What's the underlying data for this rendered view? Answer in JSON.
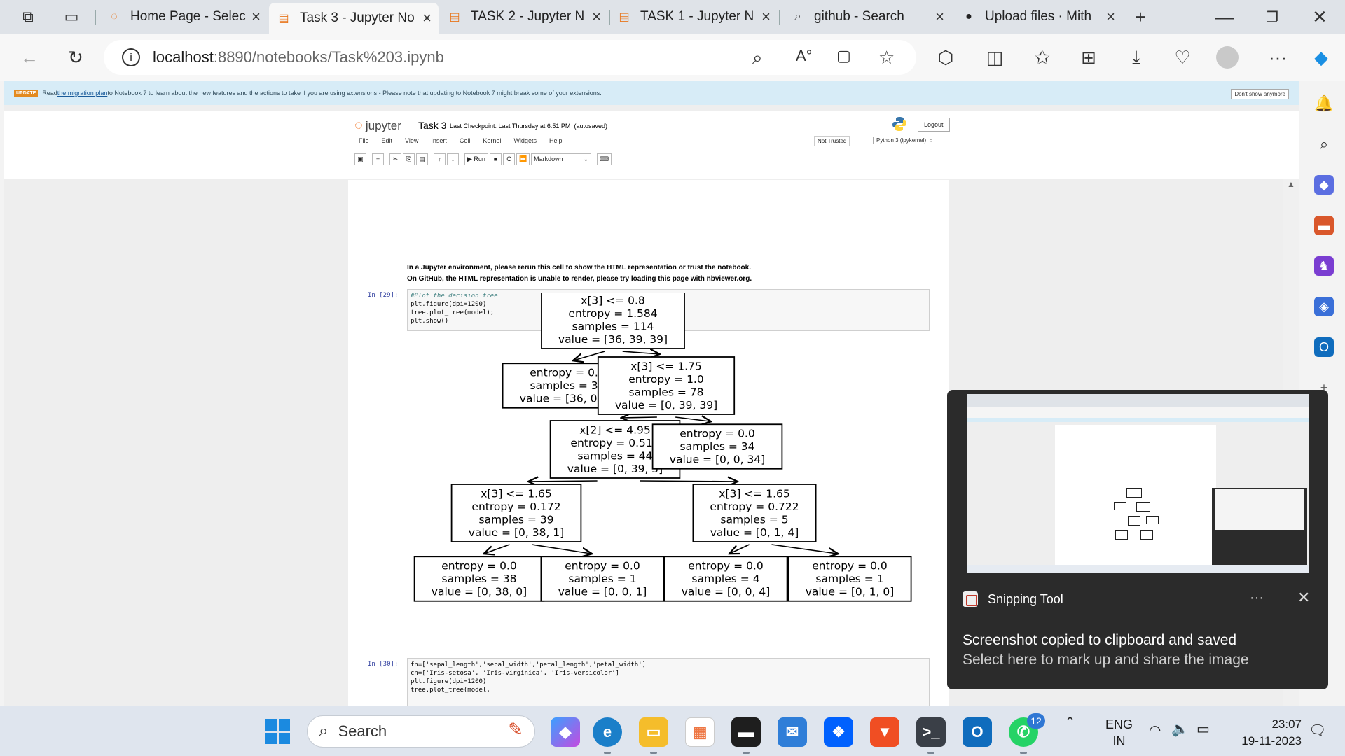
{
  "tabs": [
    {
      "title": "Home Page - Selec",
      "icon": "loading-spinner-icon",
      "active": false
    },
    {
      "title": "Task 3 - Jupyter No",
      "icon": "jupyter-notebook-icon",
      "active": true
    },
    {
      "title": "TASK 2 - Jupyter N",
      "icon": "jupyter-notebook-icon",
      "active": false
    },
    {
      "title": "TASK 1 - Jupyter N",
      "icon": "jupyter-notebook-icon",
      "active": false
    },
    {
      "title": "github - Search",
      "icon": "search-icon",
      "active": false
    },
    {
      "title": "Upload files · Mith",
      "icon": "github-icon",
      "active": false
    }
  ],
  "address": {
    "host": "localhost",
    "path": ":8890/notebooks/Task%203.ipynb"
  },
  "update_banner": {
    "badge": "UPDATE",
    "text_before": "Read ",
    "link": "the migration plan",
    "text_after": " to Notebook 7 to learn about the new features and the actions to take if you are using extensions - Please note that updating to Notebook 7 might break some of your extensions.",
    "dismiss": "Don't show anymore"
  },
  "jupyter": {
    "logo": "jupyter",
    "notebook_name": "Task 3",
    "checkpoint": "Last Checkpoint: Last Thursday at 6:51 PM",
    "autosaved": "(autosaved)",
    "logout": "Logout",
    "menu": [
      "File",
      "Edit",
      "View",
      "Insert",
      "Cell",
      "Kernel",
      "Widgets",
      "Help"
    ],
    "trust": "Not Trusted",
    "kernel": "Python 3 (ipykernel)",
    "toolbar": {
      "run": "Run",
      "cell_type": "Markdown"
    }
  },
  "notebook": {
    "note_line1": "In a Jupyter environment, please rerun this cell to show the HTML representation or trust the notebook.",
    "note_line2": "On GitHub, the HTML representation is unable to render, please try loading this page with nbviewer.org.",
    "cell29_prompt": "In [29]:",
    "cell29_code": [
      "#Plot the decision tree",
      "plt.figure(dpi=1200)",
      "tree.plot_tree(model);",
      "plt.show()"
    ],
    "cell30_prompt": "In [30]:",
    "cell30_code": [
      "fn=['sepal_length','sepal_width','petal_length','petal_width']",
      "cn=['Iris-setosa', 'Iris-virginica', 'Iris-versicolor']",
      "plt.figure(dpi=1200)",
      "tree.plot_tree(model,"
    ]
  },
  "chart_data": {
    "type": "tree",
    "nodes": [
      {
        "id": "n0",
        "lines": [
          "x[3] <= 0.8",
          "entropy = 1.584",
          "samples = 114",
          "value = [36, 39, 39]"
        ]
      },
      {
        "id": "n1",
        "lines": [
          "entropy = 0.0",
          "samples = 36",
          "value = [36, 0, 0]"
        ]
      },
      {
        "id": "n2",
        "lines": [
          "x[3] <= 1.75",
          "entropy = 1.0",
          "samples = 78",
          "value = [0, 39, 39]"
        ]
      },
      {
        "id": "n3",
        "lines": [
          "x[2] <= 4.95",
          "entropy = 0.511",
          "samples = 44",
          "value = [0, 39, 5]"
        ]
      },
      {
        "id": "n4",
        "lines": [
          "entropy = 0.0",
          "samples = 34",
          "value = [0, 0, 34]"
        ]
      },
      {
        "id": "n5",
        "lines": [
          "x[3] <= 1.65",
          "entropy = 0.172",
          "samples = 39",
          "value = [0, 38, 1]"
        ]
      },
      {
        "id": "n6",
        "lines": [
          "x[3] <= 1.65",
          "entropy = 0.722",
          "samples = 5",
          "value = [0, 1, 4]"
        ]
      },
      {
        "id": "n7",
        "lines": [
          "entropy = 0.0",
          "samples = 38",
          "value = [0, 38, 0]"
        ]
      },
      {
        "id": "n8",
        "lines": [
          "entropy = 0.0",
          "samples = 1",
          "value = [0, 0, 1]"
        ]
      },
      {
        "id": "n9",
        "lines": [
          "entropy = 0.0",
          "samples = 4",
          "value = [0, 0, 4]"
        ]
      },
      {
        "id": "n10",
        "lines": [
          "entropy = 0.0",
          "samples = 1",
          "value = [0, 1, 0]"
        ]
      }
    ],
    "edges": [
      [
        "n0",
        "n1"
      ],
      [
        "n0",
        "n2"
      ],
      [
        "n2",
        "n3"
      ],
      [
        "n2",
        "n4"
      ],
      [
        "n3",
        "n5"
      ],
      [
        "n3",
        "n6"
      ],
      [
        "n5",
        "n7"
      ],
      [
        "n5",
        "n8"
      ],
      [
        "n6",
        "n9"
      ],
      [
        "n6",
        "n10"
      ]
    ]
  },
  "toast": {
    "app": "Snipping Tool",
    "message": "Screenshot copied to clipboard and saved",
    "sub": "Select here to mark up and share the image",
    "more": "···",
    "close": "✕"
  },
  "taskbar": {
    "search": "Search",
    "whatsapp_badge": "12",
    "lang_top": "ENG",
    "lang_bottom": "IN",
    "time": "23:07",
    "date": "19-11-2023"
  }
}
